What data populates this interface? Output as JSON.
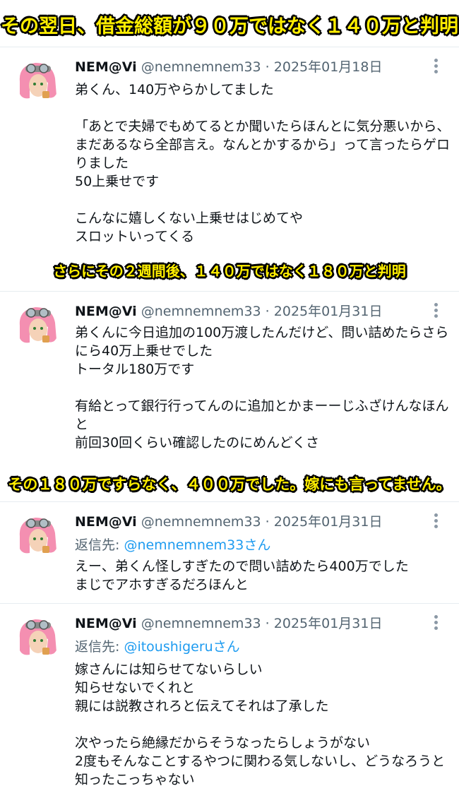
{
  "captions": [
    "その翌日、借金総額が９０万ではなく１４０万と判明",
    "さらにその２週間後、１４０万ではなく１８０万と判明",
    "その１８０万ですらなく、４００万でした。嫁にも言ってません。"
  ],
  "tweets": [
    {
      "name": "NEM@Vi",
      "handle": "@nemnemnem33",
      "dot": "·",
      "date": "2025年01月18日",
      "reply_prefix": "",
      "reply_target": "",
      "lines": [
        "弟くん、140万やらかしてました",
        "",
        "「あとで夫婦でもめてるとか聞いたらほんとに気分悪いから、",
        "まだあるなら全部言え。なんとかするから」って言ったらゲロ",
        "りました",
        "50上乗せです",
        "",
        "こんなに嬉しくない上乗せはじめてや",
        "スロットいってくる"
      ]
    },
    {
      "name": "NEM@Vi",
      "handle": "@nemnemnem33",
      "dot": "·",
      "date": "2025年01月31日",
      "reply_prefix": "",
      "reply_target": "",
      "lines": [
        "弟くんに今日追加の100万渡したんだけど、問い詰めたらさら",
        "にら40万上乗せでした",
        "トータル180万です",
        "",
        "有給とって銀行行ってんのに追加とかまーーじふざけんなほん",
        "と",
        "前回30回くらい確認したのにめんどくさ"
      ]
    },
    {
      "name": "NEM@Vi",
      "handle": "@nemnemnem33",
      "dot": "·",
      "date": "2025年01月31日",
      "reply_prefix": "返信先: ",
      "reply_target": "@nemnemnem33さん",
      "lines": [
        "えー、弟くん怪しすぎたので問い詰めたら400万でした",
        "まじでアホすぎるだろほんと"
      ]
    },
    {
      "name": "NEM@Vi",
      "handle": "@nemnemnem33",
      "dot": "·",
      "date": "2025年01月31日",
      "reply_prefix": "返信先: ",
      "reply_target": "@itoushigeruさん",
      "lines": [
        "嫁さんには知らせてないらしい",
        "知らせないでくれと",
        "親には説教されろと伝えてそれは了承した",
        "",
        "次やったら絶縁だからそうなったらしょうがない",
        "2度もそんなことするやつに関わる気しないし、どうなろうと",
        "知ったこっちゃない"
      ]
    }
  ],
  "colors": {
    "caption_fill": "#ffee00",
    "caption_outline": "#000000",
    "link": "#1d9bf0",
    "muted": "#536471",
    "divider": "#e6ecf0"
  },
  "icons": {
    "avatar": "pink-hair-goggles-avatar-icon",
    "more": "more-dots-vertical-icon"
  }
}
